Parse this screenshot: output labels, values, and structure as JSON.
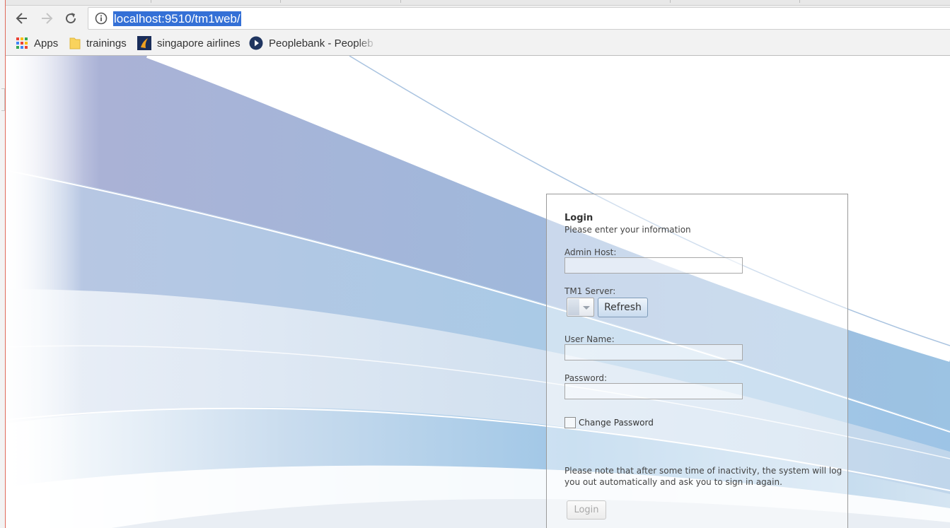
{
  "browser": {
    "address_url": "localhost:9510/tm1web/",
    "bookmarks": [
      {
        "label": "Apps",
        "icon": "apps-grid-icon"
      },
      {
        "label": "trainings",
        "icon": "folder-icon"
      },
      {
        "label": "singapore airlines",
        "icon": "singapore-airlines-logo-icon"
      },
      {
        "label": "Peoplebank - Peopleb",
        "icon": "peoplebank-play-icon"
      }
    ]
  },
  "login": {
    "title": "Login",
    "subtitle": "Please enter your information",
    "admin_host_label": "Admin Host:",
    "admin_host_value": "",
    "tm1_server_label": "TM1 Server:",
    "tm1_server_value": "",
    "refresh_label": "Refresh",
    "username_label": "User Name:",
    "username_value": "",
    "password_label": "Password:",
    "password_value": "",
    "change_password_label": "Change Password",
    "change_password_checked": false,
    "notice": "Please note that after some time of inactivity, the system will log you out automatically and ask you to sign in again.",
    "login_button_label": "Login"
  },
  "colors": {
    "url_highlight": "#3470d6",
    "wave_blue": "#9bbfe0",
    "wave_purple": "#9aa7d0",
    "refresh_border": "#7e9bb8"
  }
}
